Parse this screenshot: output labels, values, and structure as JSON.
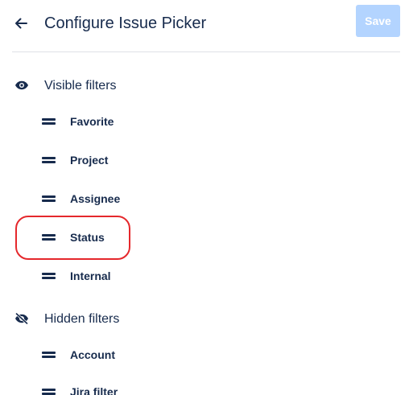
{
  "header": {
    "title": "Configure Issue Picker",
    "save_label": "Save",
    "back_icon": "arrow-left-icon"
  },
  "visible_section": {
    "label": "Visible filters",
    "icon": "eye-icon",
    "items": [
      {
        "label": "Favorite"
      },
      {
        "label": "Project"
      },
      {
        "label": "Assignee"
      },
      {
        "label": "Status"
      },
      {
        "label": "Internal"
      }
    ]
  },
  "hidden_section": {
    "label": "Hidden filters",
    "icon": "eye-off-icon",
    "items": [
      {
        "label": "Account"
      },
      {
        "label": "Jira filter"
      }
    ]
  },
  "colors": {
    "text": "#172b4d",
    "save_disabled_bg": "#b3d4ff",
    "divider": "#dfe1e6",
    "highlight": "#e5282c"
  }
}
